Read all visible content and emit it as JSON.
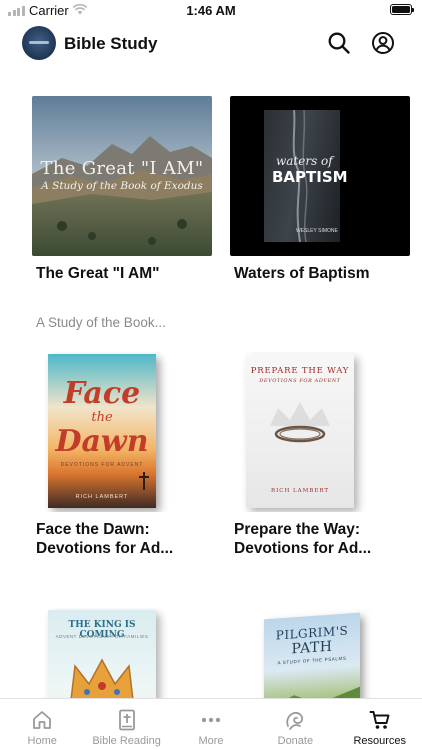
{
  "status_bar": {
    "carrier": "Carrier",
    "time": "1:46 AM"
  },
  "header": {
    "title": "Bible Study",
    "logo": "bible-study-logo",
    "search_icon": "search-icon",
    "profile_icon": "user-circle-icon"
  },
  "resources": [
    {
      "title": "The Great \"I AM\"",
      "subtitle": "A Study of the Book...",
      "cover_text": [
        "The Great \"I AM\"",
        "A Study of the Book of Exodus"
      ]
    },
    {
      "title": "Waters of Baptism",
      "cover_text": [
        "waters of",
        "BAPTISM",
        "WESLEY SIMONE"
      ]
    },
    {
      "title": "Face the Dawn:",
      "title_line2": "Devotions for Ad...",
      "cover_text": [
        "Face",
        "the",
        "Dawn",
        "DEVOTIONS FOR ADVENT",
        "RICH LAMBERT"
      ]
    },
    {
      "title": "Prepare the Way:",
      "title_line2": "Devotions for Ad...",
      "cover_text": [
        "PREPARE THE WAY",
        "DEVOTIONS FOR ADVENT",
        "RICH LAMBERT"
      ]
    },
    {
      "cover_text": [
        "THE KING IS COMING",
        "ADVENT DEVOTIONS FOR FAMILIES"
      ]
    },
    {
      "cover_text": [
        "PILGRIM'S",
        "PATH",
        "A STUDY OF THE PSALMS"
      ]
    }
  ],
  "tabs": [
    {
      "label": "Home",
      "icon": "home-icon",
      "active": false
    },
    {
      "label": "Bible Reading",
      "icon": "bible-icon",
      "active": false
    },
    {
      "label": "More",
      "icon": "more-dots-icon",
      "active": false
    },
    {
      "label": "Donate",
      "icon": "donate-icon",
      "active": false
    },
    {
      "label": "Resources",
      "icon": "cart-icon",
      "active": true
    }
  ],
  "colors": {
    "active_tab": "#111111",
    "inactive_tab": "#999999",
    "subtitle": "#8a8a8a"
  }
}
